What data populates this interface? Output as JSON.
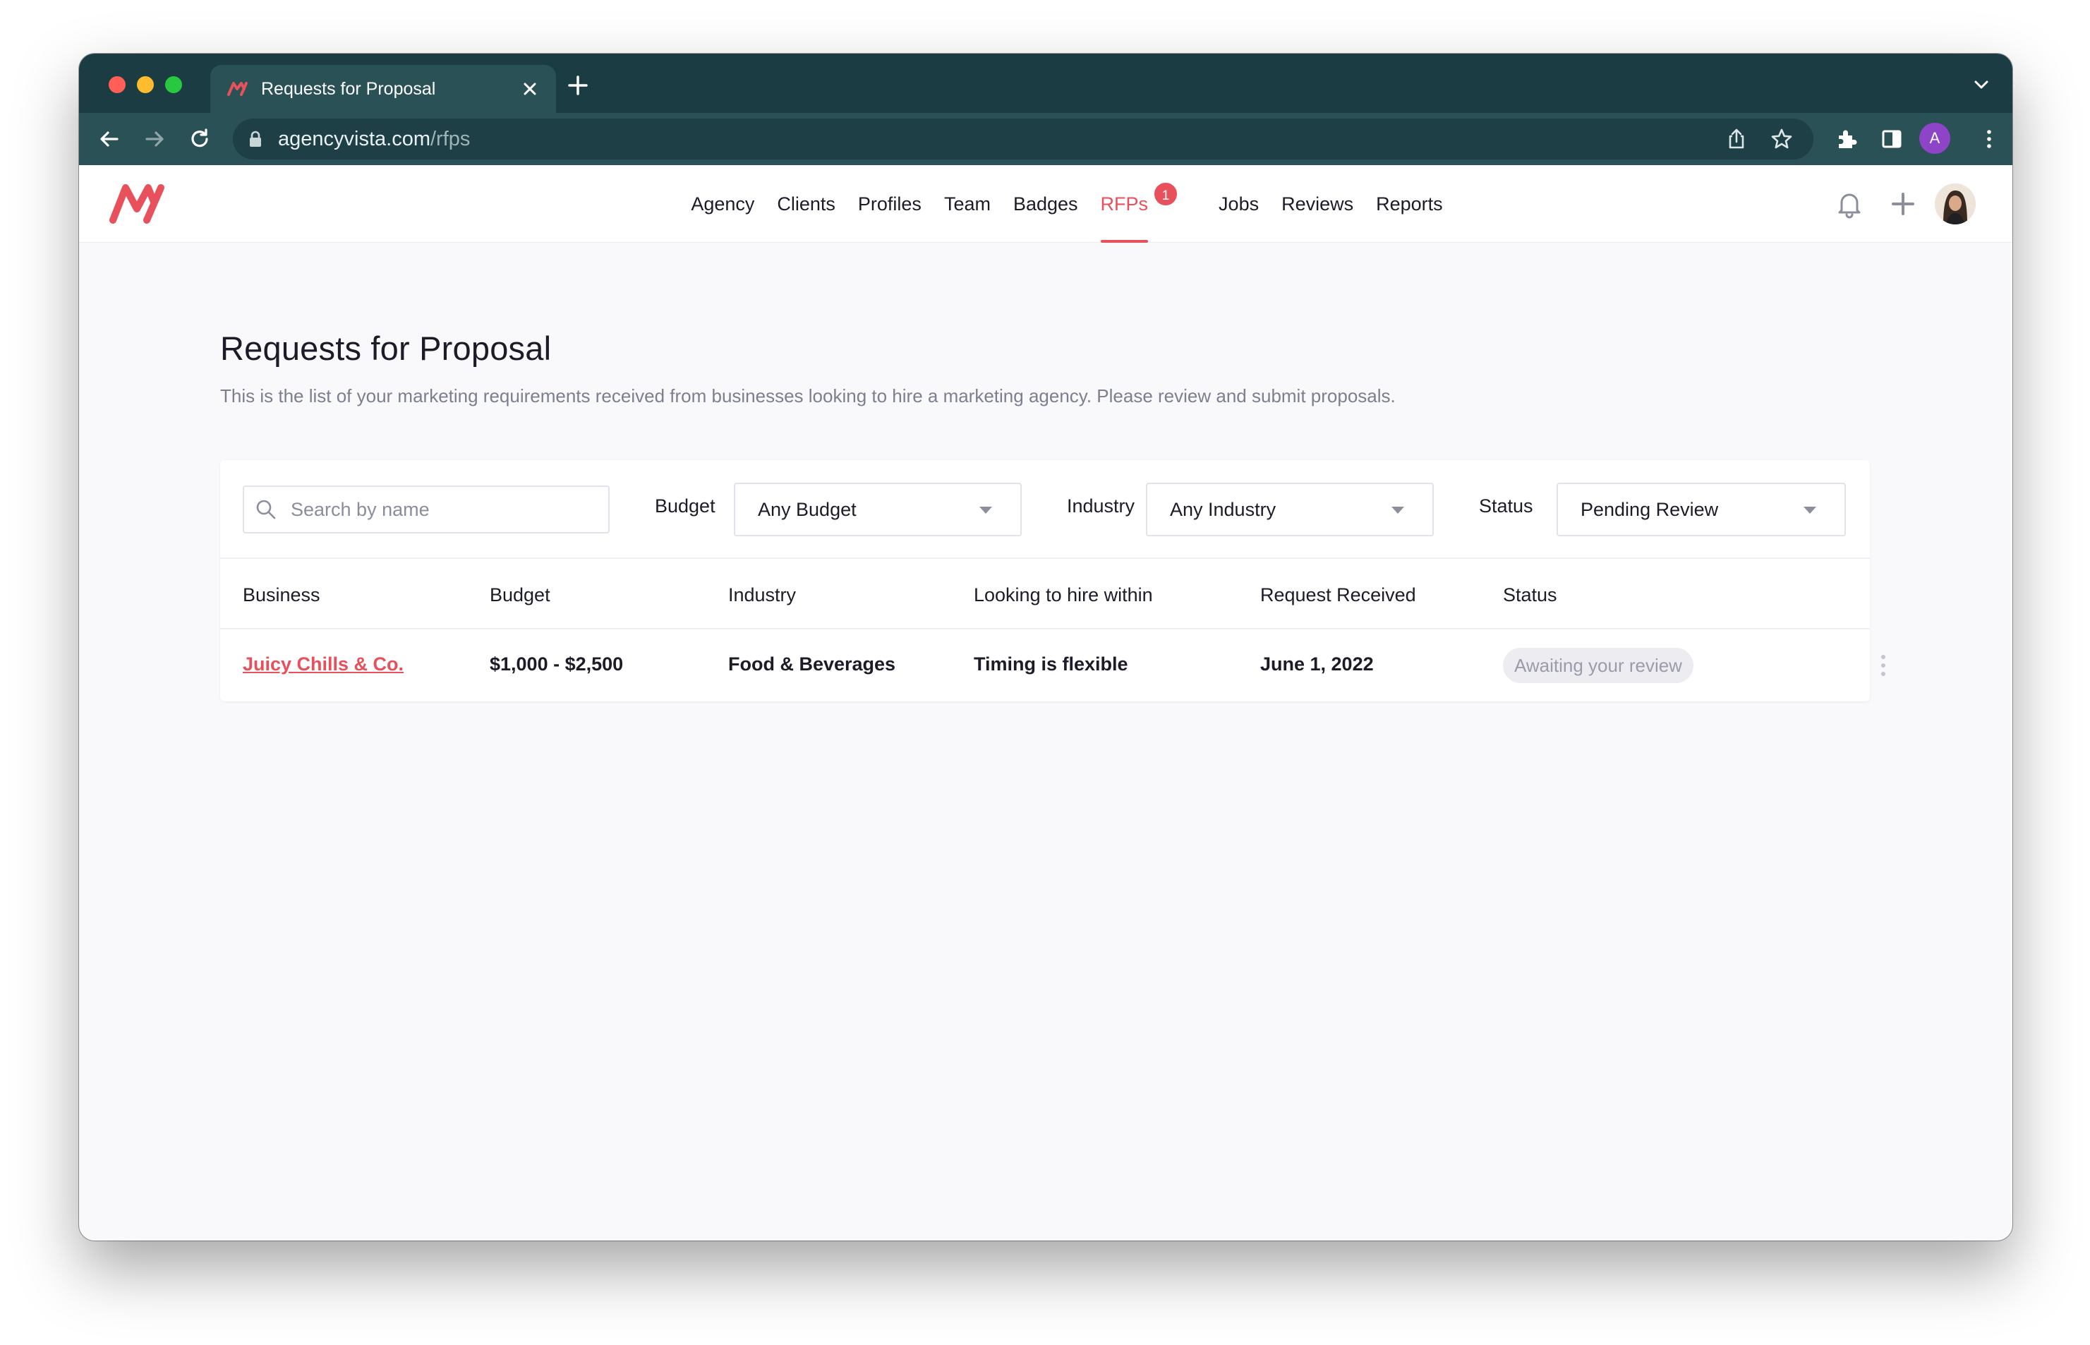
{
  "browser": {
    "tab_title": "Requests for Proposal",
    "url_domain": "agencyvista.com",
    "url_path": "/rfps",
    "profile_initial": "A"
  },
  "nav": {
    "items": [
      {
        "label": "Agency"
      },
      {
        "label": "Clients"
      },
      {
        "label": "Profiles"
      },
      {
        "label": "Team"
      },
      {
        "label": "Badges"
      },
      {
        "label": "RFPs",
        "active": true,
        "badge": "1"
      },
      {
        "label": "Jobs"
      },
      {
        "label": "Reviews"
      },
      {
        "label": "Reports"
      }
    ]
  },
  "page": {
    "title": "Requests for Proposal",
    "description": "This is the list of your marketing requirements received from businesses looking to hire a marketing agency. Please review and submit proposals."
  },
  "filters": {
    "search_placeholder": "Search by name",
    "budget_label": "Budget",
    "budget_value": "Any Budget",
    "industry_label": "Industry",
    "industry_value": "Any Industry",
    "status_label": "Status",
    "status_value": "Pending Review"
  },
  "table": {
    "columns": [
      "Business",
      "Budget",
      "Industry",
      "Looking to hire within",
      "Request Received",
      "Status"
    ],
    "rows": [
      {
        "business": "Juicy Chills & Co.",
        "budget": "$1,000 - $2,500",
        "industry": "Food & Beverages",
        "hire_within": "Timing is flexible",
        "received": "June 1, 2022",
        "status": "Awaiting your review"
      }
    ]
  },
  "colors": {
    "brand": "#e8505b",
    "chrome_dark": "#1a3c42",
    "chrome_toolbar": "#2a5156",
    "text": "#1c1c28",
    "muted": "#7c7f8f"
  },
  "icons": {
    "logo": "agencyvista-logo",
    "notifications": "bell-icon",
    "create": "plus-icon",
    "search": "search-icon",
    "row_menu": "more-vertical-icon"
  }
}
